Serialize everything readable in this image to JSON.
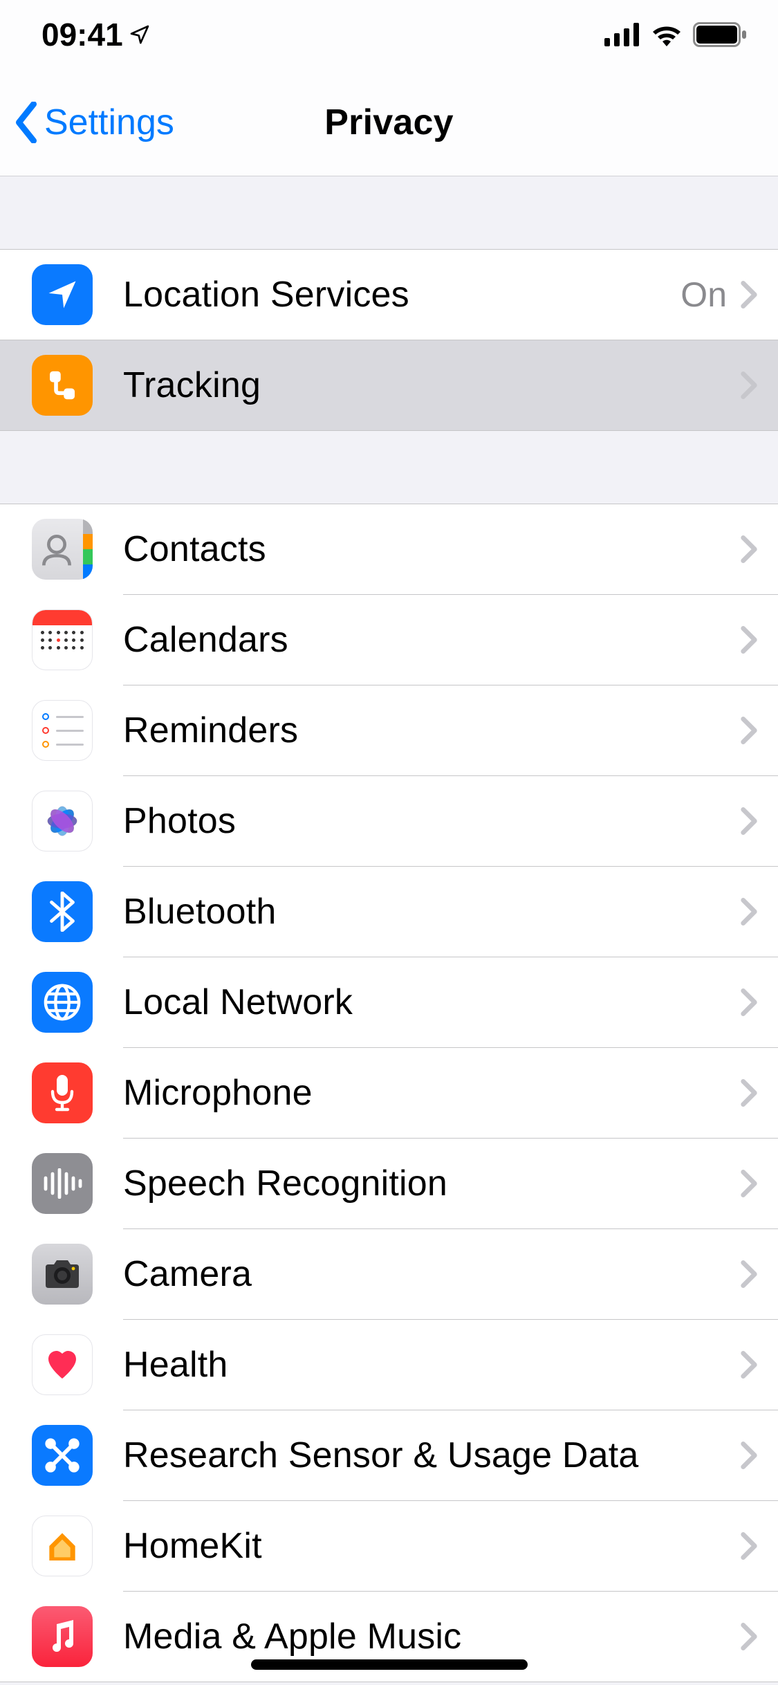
{
  "status": {
    "time": "09:41"
  },
  "nav": {
    "back_label": "Settings",
    "title": "Privacy"
  },
  "groups": [
    {
      "rows": [
        {
          "id": "location-services",
          "label": "Location Services",
          "value": "On"
        },
        {
          "id": "tracking",
          "label": "Tracking",
          "pressed": true
        }
      ]
    },
    {
      "rows": [
        {
          "id": "contacts",
          "label": "Contacts"
        },
        {
          "id": "calendars",
          "label": "Calendars"
        },
        {
          "id": "reminders",
          "label": "Reminders"
        },
        {
          "id": "photos",
          "label": "Photos"
        },
        {
          "id": "bluetooth",
          "label": "Bluetooth"
        },
        {
          "id": "local-network",
          "label": "Local Network"
        },
        {
          "id": "microphone",
          "label": "Microphone"
        },
        {
          "id": "speech-recognition",
          "label": "Speech Recognition"
        },
        {
          "id": "camera",
          "label": "Camera"
        },
        {
          "id": "health",
          "label": "Health"
        },
        {
          "id": "research-sensor",
          "label": "Research Sensor & Usage Data"
        },
        {
          "id": "homekit",
          "label": "HomeKit"
        },
        {
          "id": "media-apple-music",
          "label": "Media & Apple Music"
        }
      ]
    }
  ]
}
